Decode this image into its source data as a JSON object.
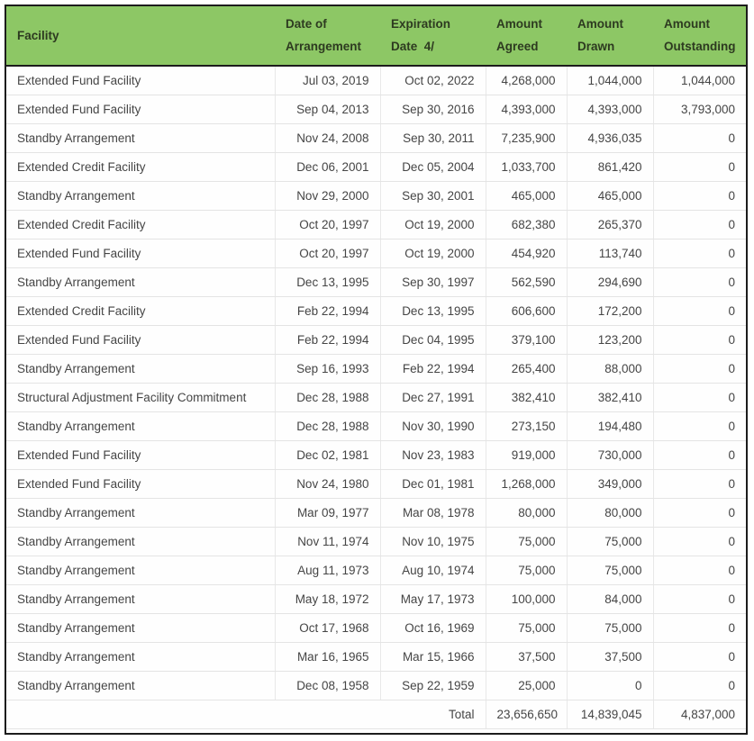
{
  "table": {
    "columns": [
      {
        "key": "facility",
        "line1": "Facility",
        "line2": "",
        "align": "left"
      },
      {
        "key": "arranged",
        "line1": "Date of",
        "line2": "Arrangement",
        "align": "left"
      },
      {
        "key": "expiration",
        "line1": "Expiration",
        "line2": "Date  4/",
        "align": "left"
      },
      {
        "key": "agreed",
        "line1": "Amount",
        "line2": "Agreed",
        "align": "left"
      },
      {
        "key": "drawn",
        "line1": "Amount",
        "line2": "Drawn",
        "align": "left"
      },
      {
        "key": "outstanding",
        "line1": "Amount",
        "line2": "Outstanding",
        "align": "left"
      }
    ],
    "rows": [
      {
        "facility": "Extended Fund Facility",
        "arranged": "Jul 03, 2019",
        "expiration": "Oct 02, 2022",
        "agreed": "4,268,000",
        "drawn": "1,044,000",
        "outstanding": "1,044,000"
      },
      {
        "facility": "Extended Fund Facility",
        "arranged": "Sep 04, 2013",
        "expiration": "Sep 30, 2016",
        "agreed": "4,393,000",
        "drawn": "4,393,000",
        "outstanding": "3,793,000"
      },
      {
        "facility": "Standby Arrangement",
        "arranged": "Nov 24, 2008",
        "expiration": "Sep 30, 2011",
        "agreed": "7,235,900",
        "drawn": "4,936,035",
        "outstanding": "0"
      },
      {
        "facility": "Extended Credit Facility",
        "arranged": "Dec 06, 2001",
        "expiration": "Dec 05, 2004",
        "agreed": "1,033,700",
        "drawn": "861,420",
        "outstanding": "0"
      },
      {
        "facility": "Standby Arrangement",
        "arranged": "Nov 29, 2000",
        "expiration": "Sep 30, 2001",
        "agreed": "465,000",
        "drawn": "465,000",
        "outstanding": "0"
      },
      {
        "facility": "Extended Credit Facility",
        "arranged": "Oct 20, 1997",
        "expiration": "Oct 19, 2000",
        "agreed": "682,380",
        "drawn": "265,370",
        "outstanding": "0"
      },
      {
        "facility": "Extended Fund Facility",
        "arranged": "Oct 20, 1997",
        "expiration": "Oct 19, 2000",
        "agreed": "454,920",
        "drawn": "113,740",
        "outstanding": "0"
      },
      {
        "facility": "Standby Arrangement",
        "arranged": "Dec 13, 1995",
        "expiration": "Sep 30, 1997",
        "agreed": "562,590",
        "drawn": "294,690",
        "outstanding": "0"
      },
      {
        "facility": "Extended Credit Facility",
        "arranged": "Feb 22, 1994",
        "expiration": "Dec 13, 1995",
        "agreed": "606,600",
        "drawn": "172,200",
        "outstanding": "0"
      },
      {
        "facility": "Extended Fund Facility",
        "arranged": "Feb 22, 1994",
        "expiration": "Dec 04, 1995",
        "agreed": "379,100",
        "drawn": "123,200",
        "outstanding": "0"
      },
      {
        "facility": "Standby Arrangement",
        "arranged": "Sep 16, 1993",
        "expiration": "Feb 22, 1994",
        "agreed": "265,400",
        "drawn": "88,000",
        "outstanding": "0"
      },
      {
        "facility": "Structural Adjustment Facility Commitment",
        "arranged": "Dec 28, 1988",
        "expiration": "Dec 27, 1991",
        "agreed": "382,410",
        "drawn": "382,410",
        "outstanding": "0"
      },
      {
        "facility": "Standby Arrangement",
        "arranged": "Dec 28, 1988",
        "expiration": "Nov 30, 1990",
        "agreed": "273,150",
        "drawn": "194,480",
        "outstanding": "0"
      },
      {
        "facility": "Extended Fund Facility",
        "arranged": "Dec 02, 1981",
        "expiration": "Nov 23, 1983",
        "agreed": "919,000",
        "drawn": "730,000",
        "outstanding": "0"
      },
      {
        "facility": "Extended Fund Facility",
        "arranged": "Nov 24, 1980",
        "expiration": "Dec 01, 1981",
        "agreed": "1,268,000",
        "drawn": "349,000",
        "outstanding": "0"
      },
      {
        "facility": "Standby Arrangement",
        "arranged": "Mar 09, 1977",
        "expiration": "Mar 08, 1978",
        "agreed": "80,000",
        "drawn": "80,000",
        "outstanding": "0"
      },
      {
        "facility": "Standby Arrangement",
        "arranged": "Nov 11, 1974",
        "expiration": "Nov 10, 1975",
        "agreed": "75,000",
        "drawn": "75,000",
        "outstanding": "0"
      },
      {
        "facility": "Standby Arrangement",
        "arranged": "Aug 11, 1973",
        "expiration": "Aug 10, 1974",
        "agreed": "75,000",
        "drawn": "75,000",
        "outstanding": "0"
      },
      {
        "facility": "Standby Arrangement",
        "arranged": "May 18, 1972",
        "expiration": "May 17, 1973",
        "agreed": "100,000",
        "drawn": "84,000",
        "outstanding": "0"
      },
      {
        "facility": "Standby Arrangement",
        "arranged": "Oct 17, 1968",
        "expiration": "Oct 16, 1969",
        "agreed": "75,000",
        "drawn": "75,000",
        "outstanding": "0"
      },
      {
        "facility": "Standby Arrangement",
        "arranged": "Mar 16, 1965",
        "expiration": "Mar 15, 1966",
        "agreed": "37,500",
        "drawn": "37,500",
        "outstanding": "0"
      },
      {
        "facility": "Standby Arrangement",
        "arranged": "Dec 08, 1958",
        "expiration": "Sep 22, 1959",
        "agreed": "25,000",
        "drawn": "0",
        "outstanding": "0"
      }
    ],
    "total": {
      "label": "Total",
      "agreed": "23,656,650",
      "drawn": "14,839,045",
      "outstanding": "4,837,000"
    }
  },
  "colors": {
    "header_background": "#8dc765",
    "header_text": "#2d3a20",
    "body_text": "#454545",
    "frame_border": "#1c1c1c",
    "row_separator": "#e4e4e4"
  }
}
